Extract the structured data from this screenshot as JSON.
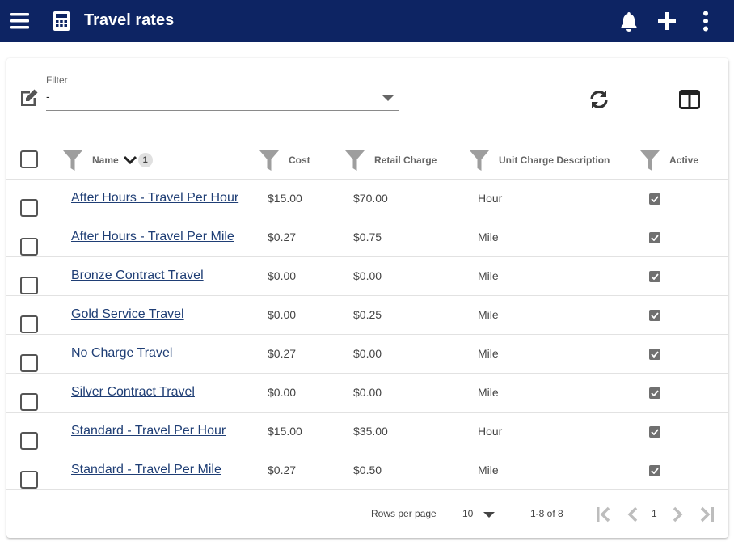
{
  "app": {
    "title": "Travel rates"
  },
  "filter": {
    "label": "Filter",
    "value": "-"
  },
  "columns": {
    "name": "Name",
    "name_sort_order": "1",
    "cost": "Cost",
    "retail": "Retail Charge",
    "unit": "Unit Charge Description",
    "active": "Active"
  },
  "rows": [
    {
      "name": "After Hours - Travel Per Hour",
      "cost": "$15.00",
      "retail": "$70.00",
      "unit": "Hour",
      "active": true
    },
    {
      "name": "After Hours - Travel Per Mile",
      "cost": "$0.27",
      "retail": "$0.75",
      "unit": "Mile",
      "active": true
    },
    {
      "name": "Bronze Contract Travel",
      "cost": "$0.00",
      "retail": "$0.00",
      "unit": "Mile",
      "active": true
    },
    {
      "name": "Gold Service Travel",
      "cost": "$0.00",
      "retail": "$0.25",
      "unit": "Mile",
      "active": true
    },
    {
      "name": "No Charge Travel",
      "cost": "$0.27",
      "retail": "$0.00",
      "unit": "Mile",
      "active": true
    },
    {
      "name": "Silver Contract Travel",
      "cost": "$0.00",
      "retail": "$0.00",
      "unit": "Mile",
      "active": true
    },
    {
      "name": "Standard - Travel Per Hour",
      "cost": "$15.00",
      "retail": "$35.00",
      "unit": "Hour",
      "active": true
    },
    {
      "name": "Standard - Travel Per Mile",
      "cost": "$0.27",
      "retail": "$0.50",
      "unit": "Mile",
      "active": true
    }
  ],
  "pagination": {
    "rows_per_page_label": "Rows per page",
    "rows_per_page": "10",
    "range": "1-8 of 8",
    "page": "1"
  },
  "colors": {
    "appbar": "#0d2463",
    "link": "#1f3e75"
  }
}
